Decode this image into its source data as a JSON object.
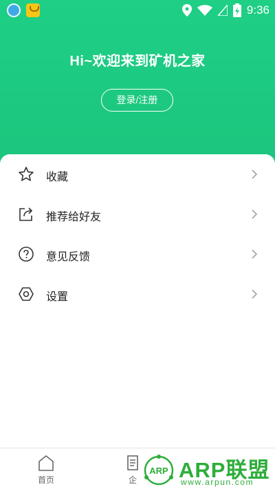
{
  "status_bar": {
    "time": "9:36",
    "icons": [
      "app-notification-icon",
      "shopping-bag-app-icon",
      "location-pin-icon",
      "wifi-icon",
      "cellular-signal-icon",
      "battery-charging-icon"
    ]
  },
  "header": {
    "welcome_text": "Hi~欢迎来到矿机之家",
    "login_button_label": "登录/注册",
    "background_color": "#1fcf86"
  },
  "menu": {
    "items": [
      {
        "label": "收藏",
        "icon": "star-icon"
      },
      {
        "label": "推荐给好友",
        "icon": "share-icon"
      },
      {
        "label": "意见反馈",
        "icon": "question-circle-icon"
      },
      {
        "label": "设置",
        "icon": "settings-hexagon-icon"
      }
    ],
    "chevron_icon": "chevron-right-icon"
  },
  "tabbar": {
    "tabs": [
      {
        "label": "首页",
        "icon": "home-icon"
      },
      {
        "label": "企",
        "icon": "document-icon"
      }
    ]
  },
  "watermark": {
    "logo_text": "ARP",
    "brand_text": "ARP联盟",
    "url": "www.arpun.com",
    "color": "#2dae3a"
  }
}
